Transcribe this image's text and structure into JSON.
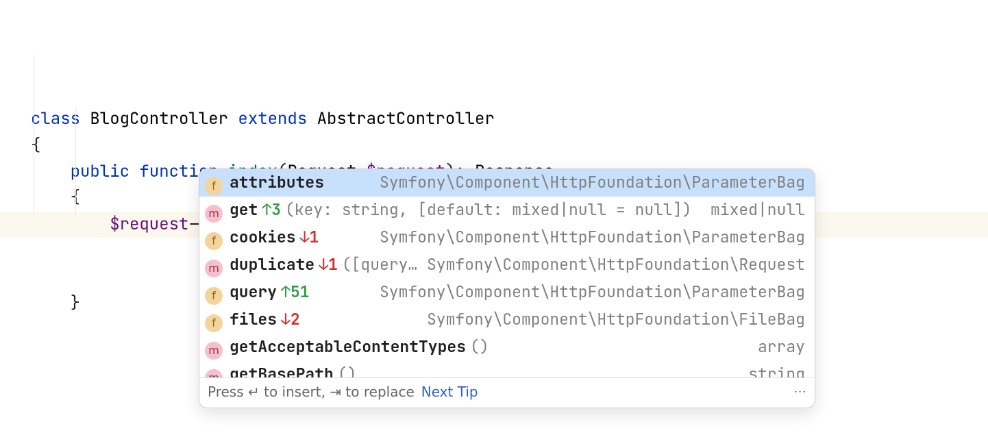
{
  "code": {
    "kw_class": "class",
    "class_name": "BlogController",
    "kw_extends": "extends",
    "super_class": "AbstractController",
    "brace_open": "{",
    "kw_public": "public",
    "kw_function": "function",
    "fn_name": "index",
    "paren_open": "(",
    "param_type": "Request",
    "param_name": "$request",
    "paren_close_colon": "): ",
    "return_type": "Response",
    "fn_brace_open": "{",
    "expr_var": "$request",
    "expr_arrow": "->",
    "fn_brace_close": "}"
  },
  "completion": {
    "items": [
      {
        "badge": "f",
        "name": "attributes",
        "arrow": "",
        "sig": "",
        "type": "Symfony\\Component\\HttpFoundation\\ParameterBag",
        "selected": true
      },
      {
        "badge": "m",
        "name": "get",
        "arrow": "↑3",
        "arrow_dir": "up",
        "sig": "(key: string, [default: mixed|null = null])",
        "type": "mixed|null"
      },
      {
        "badge": "f",
        "name": "cookies",
        "arrow": "↓1",
        "arrow_dir": "down",
        "sig": "",
        "type": "Symfony\\Component\\HttpFoundation\\ParameterBag"
      },
      {
        "badge": "m",
        "name": "duplicate",
        "arrow": "↓1",
        "arrow_dir": "down",
        "sig": "([query:…",
        "type": "Symfony\\Component\\HttpFoundation\\Request"
      },
      {
        "badge": "f",
        "name": "query",
        "arrow": "↑51",
        "arrow_dir": "up",
        "sig": "",
        "type": "Symfony\\Component\\HttpFoundation\\ParameterBag"
      },
      {
        "badge": "f",
        "name": "files",
        "arrow": "↓2",
        "arrow_dir": "down",
        "sig": "",
        "type": "Symfony\\Component\\HttpFoundation\\FileBag"
      },
      {
        "badge": "m",
        "name": "getAcceptableContentTypes",
        "arrow": "",
        "sig": "()",
        "type": "array"
      },
      {
        "badge": "m",
        "name": "getBasePath",
        "arrow": "",
        "sig": "()",
        "type": "string"
      }
    ],
    "footer_hint_1": "Press ",
    "footer_key_enter": "↵",
    "footer_hint_2": " to insert, ",
    "footer_key_tab": "⇥",
    "footer_hint_3": " to replace",
    "footer_link": "Next Tip",
    "footer_more": "⋮"
  }
}
